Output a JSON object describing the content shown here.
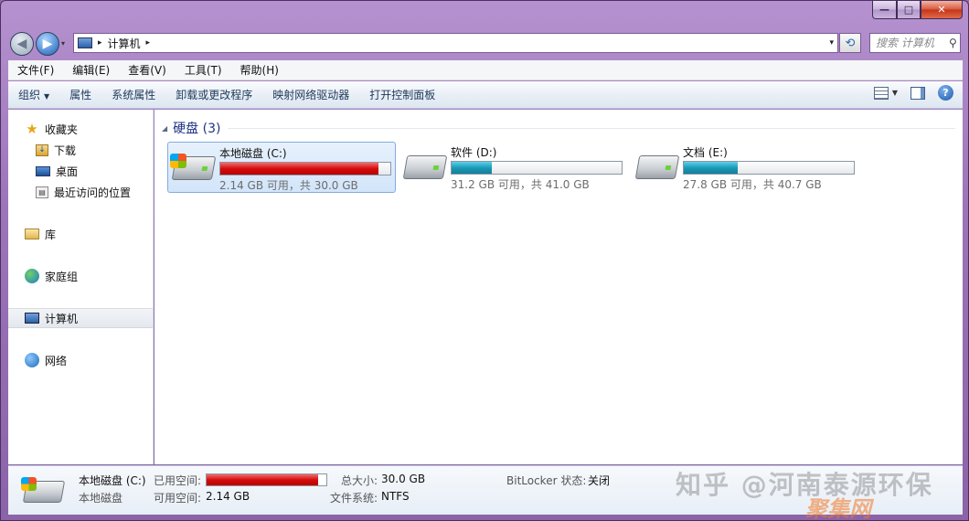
{
  "window": {
    "min_label": "—",
    "max_label": "□",
    "close_label": "✕"
  },
  "nav": {
    "back_glyph": "◀",
    "forward_glyph": "▶",
    "recent_glyph": "▾"
  },
  "address": {
    "separator": "▸",
    "location": "计算机",
    "trail_separator": "▸",
    "dropdown_glyph": "▾",
    "refresh_glyph": "⟲"
  },
  "search": {
    "placeholder": "搜索 计算机",
    "icon_glyph": "⚲"
  },
  "menubar": {
    "items": [
      "文件(F)",
      "编辑(E)",
      "查看(V)",
      "工具(T)",
      "帮助(H)"
    ]
  },
  "commandbar": {
    "organize": "组织",
    "organize_caret": "▼",
    "properties": "属性",
    "system_properties": "系统属性",
    "uninstall": "卸载或更改程序",
    "map_drive": "映射网络驱动器",
    "control_panel": "打开控制面板",
    "view_caret": "▼",
    "help_glyph": "?"
  },
  "sidebar": {
    "favorites": "收藏夹",
    "downloads": "下载",
    "desktop": "桌面",
    "recent": "最近访问的位置",
    "libraries": "库",
    "homegroup": "家庭组",
    "computer": "计算机",
    "network": "网络",
    "star_glyph": "★",
    "download_glyph": "↓",
    "recent_glyph": "▤"
  },
  "content": {
    "group_caret": "◢",
    "group_title": "硬盘 (3)",
    "drives": [
      {
        "name": "本地磁盘 (C:)",
        "info": "2.14 GB 可用，共 30.0 GB",
        "used_fraction": 0.929
      },
      {
        "name": "软件 (D:)",
        "info": "31.2 GB 可用，共 41.0 GB",
        "used_fraction": 0.239
      },
      {
        "name": "文档 (E:)",
        "info": "27.8 GB 可用，共 40.7 GB",
        "used_fraction": 0.317
      }
    ]
  },
  "details": {
    "title": "本地磁盘 (C:)",
    "subtitle": "本地磁盘",
    "used_label": "已用空间:",
    "used_fraction": 0.929,
    "free_label": "可用空间:",
    "free_value": "2.14 GB",
    "total_label": "总大小:",
    "total_value": "30.0 GB",
    "fs_label": "文件系统:",
    "fs_value": "NTFS",
    "bitlocker_label": "BitLocker 状态:",
    "bitlocker_value": "关闭"
  },
  "watermark": {
    "line1": "知乎 @河南泰源环保",
    "line2": "聚集网"
  },
  "colors": {
    "accent_titlebar": "#9c74b9",
    "bar_red": "#d50d0d",
    "bar_teal": "#1a9bb8",
    "group_title": "#1e3287"
  }
}
